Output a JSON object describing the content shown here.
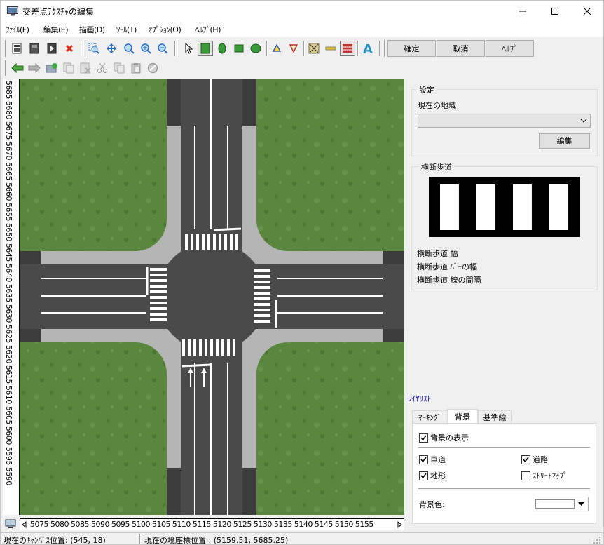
{
  "window": {
    "title": "交差点ﾃｸｽﾁｬの編集"
  },
  "menu": [
    "ﾌｧｲﾙ(F)",
    "編集(E)",
    "描画(D)",
    "ﾂｰﾙ(T)",
    "ｵﾌﾟｼｮﾝ(O)",
    "ﾍﾙﾌﾟ(H)"
  ],
  "toolbar": {
    "confirm_label": "確定",
    "cancel_label": "取消",
    "help_label": "ﾍﾙﾌﾟ"
  },
  "ruler": {
    "vertical": "5685 5680 5675 5670 5665 5660 5655 5650 5645 5640 5635 5630 5625 5620 5615 5610 5605 5600 5595 5590",
    "horizontal": "5075 5080 5085 5090 5095 5100 5105 5110 5115 5120 5125 5130 5135 5140 5145 5150 5155"
  },
  "settings": {
    "group_label": "設定",
    "region_label": "現在の地域",
    "region_value": "",
    "edit_label": "編集"
  },
  "crosswalk": {
    "group_label": "横断歩道",
    "width_label": "横断歩道 幅",
    "bar_width_label": "横断歩道 ﾊﾞｰの幅",
    "line_gap_label": "横断歩道 線の間隔"
  },
  "layers": {
    "title": "ﾚｲﾔﾘｽﾄ",
    "tabs": [
      "ﾏｰｷﾝｸﾞ",
      "背景",
      "基準線"
    ],
    "active_tab": "背景",
    "show_background": {
      "label": "背景の表示",
      "checked": true
    },
    "roadway": {
      "label": "車道",
      "checked": true
    },
    "road": {
      "label": "道路",
      "checked": true
    },
    "terrain": {
      "label": "地形",
      "checked": true
    },
    "streetmap": {
      "label": "ｽﾄﾘｰﾄﾏｯﾌﾟ",
      "checked": false
    },
    "bg_color_label": "背景色:",
    "bg_color": "#ffffff"
  },
  "status": {
    "canvas_pos": "現在のｷｬﾝﾊﾞｽ位置: (545, 18)",
    "world_pos": "現在の境座標位置 : (5159.51, 5685.25)"
  },
  "colors": {
    "grass": "#5a8a3c",
    "asphalt": "#4a4a4a",
    "sidewalk": "#b8b8b8",
    "marking": "#ffffff",
    "link": "#0000cc"
  }
}
